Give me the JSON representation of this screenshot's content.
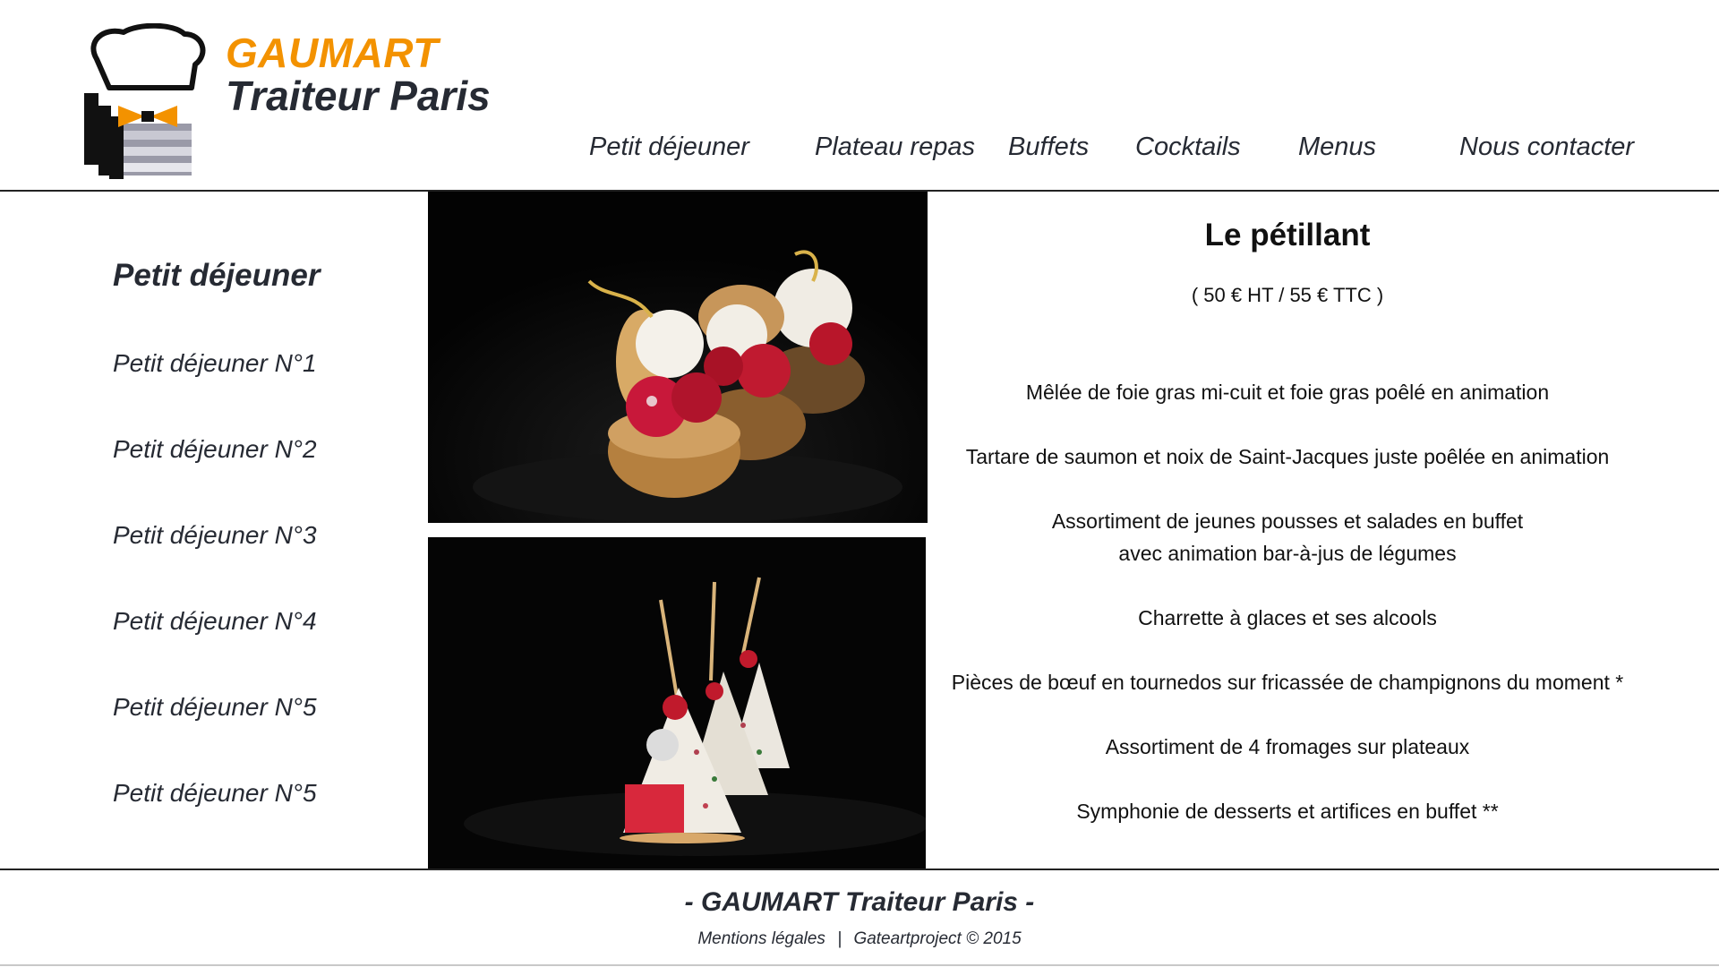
{
  "brand": {
    "line1": "GAUMART",
    "line2": "Traiteur Paris",
    "accent_color": "#f39200",
    "text_color": "#262a33"
  },
  "nav": {
    "items": [
      {
        "label": "Petit déjeuner"
      },
      {
        "label": "Plateau repas"
      },
      {
        "label": "Buffets"
      },
      {
        "label": "Cocktails"
      },
      {
        "label": "Menus"
      },
      {
        "label": "Nous contacter"
      }
    ]
  },
  "sidebar": {
    "title": "Petit déjeuner",
    "items": [
      {
        "label": "Petit déjeuner N°1"
      },
      {
        "label": "Petit déjeuner N°2"
      },
      {
        "label": "Petit déjeuner N°3"
      },
      {
        "label": "Petit déjeuner N°4"
      },
      {
        "label": "Petit déjeuner N°5"
      },
      {
        "label": "Petit déjeuner N°5"
      }
    ]
  },
  "photos": [
    {
      "subject": "choux pastries with raspberries and cream"
    },
    {
      "subject": "triangle pastries with cherries on picks"
    }
  ],
  "menu": {
    "title": "Le pétillant",
    "price": "( 50 € HT / 55 € TTC )",
    "items": [
      {
        "line1": "Mêlée de foie gras mi-cuit et foie gras poêlé en animation",
        "line2": ""
      },
      {
        "line1": "Tartare de saumon et noix de Saint-Jacques juste poêlée en animation",
        "line2": ""
      },
      {
        "line1": "Assortiment de jeunes pousses et salades en buffet",
        "line2": "avec animation bar-à-jus de légumes"
      },
      {
        "line1": "Charrette à glaces et ses alcools",
        "line2": ""
      },
      {
        "line1": "Pièces de bœuf en tournedos sur fricassée de champignons du moment *",
        "line2": ""
      },
      {
        "line1": "Assortiment de 4 fromages sur plateaux",
        "line2": ""
      },
      {
        "line1": "Symphonie de desserts et artifices en buffet **",
        "line2": ""
      }
    ]
  },
  "footer": {
    "title": "- GAUMART Traiteur Paris -",
    "legal": "Mentions légales",
    "separator": "|",
    "credit": "Gateartproject © 2015"
  }
}
